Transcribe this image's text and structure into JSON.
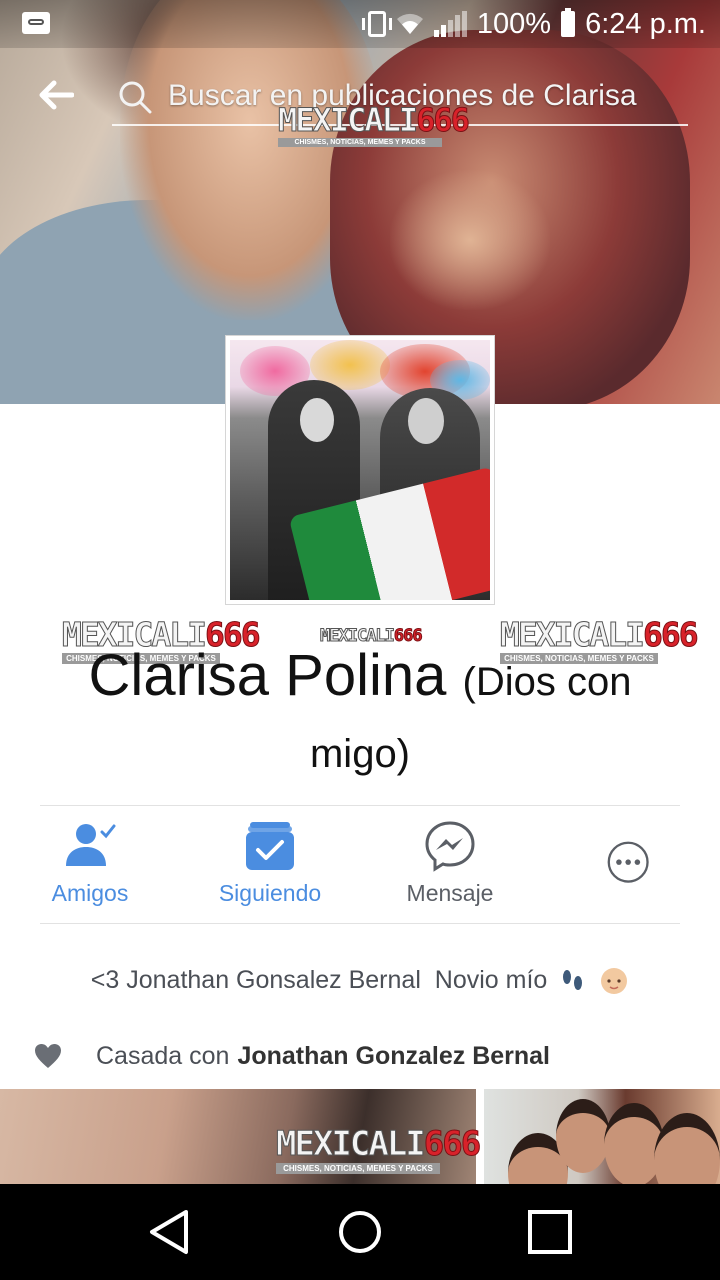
{
  "status_bar": {
    "battery": "100%",
    "time": "6:24 p.m.",
    "icons": [
      "voicemail-icon",
      "vibrate-icon",
      "wifi-icon",
      "signal-icon",
      "battery-icon"
    ]
  },
  "header": {
    "search_placeholder": "Buscar en publicaciones de Clarisa"
  },
  "watermarks": {
    "brand_a": "MEXICALI",
    "brand_b": "666",
    "tagline": "CHISMES, NOTICIAS, MEMES Y PACKS"
  },
  "profile": {
    "name": "Clarisa Polina",
    "alt_name_part1": "(Dios con",
    "alt_name_part2": "migo)"
  },
  "actions": [
    {
      "label": "Amigos",
      "icon": "friends-check-icon"
    },
    {
      "label": "Siguiendo",
      "icon": "following-check-icon"
    },
    {
      "label": "Mensaje",
      "icon": "messenger-icon"
    },
    {
      "label": "",
      "icon": "more-icon"
    }
  ],
  "bio": {
    "text": "<3 Jonathan Gonsalez Bernal  Novio mío",
    "emojis": [
      "footprints-emoji",
      "baby-emoji"
    ]
  },
  "relationship": {
    "prefix": "Casada con",
    "partner": "Jonathan Gonzalez Bernal"
  },
  "colors": {
    "accent_blue": "#4b8de0",
    "text_gray": "#4b4f56",
    "navbar": "#000000"
  }
}
